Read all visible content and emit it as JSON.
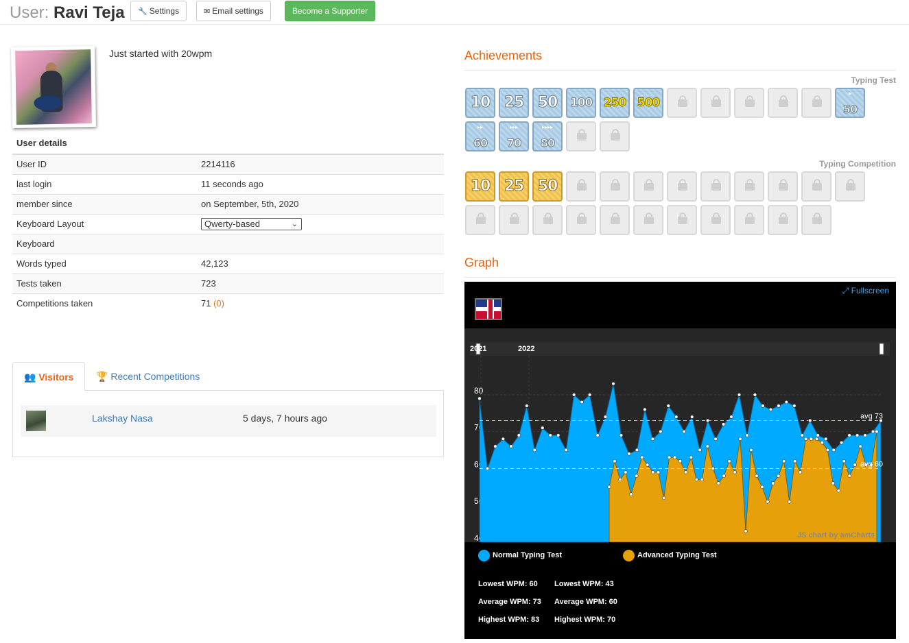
{
  "header": {
    "prefix": "User:",
    "username": "Ravi Teja",
    "settings_label": "Settings",
    "email_settings_label": "Email settings",
    "supporter_label": "Become a Supporter"
  },
  "profile": {
    "tagline": "Just started with 20wpm",
    "details_title": "User details",
    "rows": [
      {
        "label": "User ID",
        "value": "2214116"
      },
      {
        "label": "last login",
        "value": "11 seconds ago"
      },
      {
        "label": "member since",
        "value": "on September, 5th, 2020"
      },
      {
        "label": "Keyboard Layout",
        "value": "Qwerty-based"
      },
      {
        "label": "Keyboard",
        "value": ""
      },
      {
        "label": "Words typed",
        "value": "42,123"
      },
      {
        "label": "Tests taken",
        "value": "723"
      },
      {
        "label": "Competitions taken",
        "value": "71",
        "extra": "(0)"
      }
    ]
  },
  "tabs": {
    "visitors_label": "Visitors",
    "competitions_label": "Recent Competitions",
    "visitors": [
      {
        "name": "Lakshay Nasa",
        "time": "5 days, 7 hours ago"
      }
    ]
  },
  "achievements": {
    "title": "Achievements",
    "typing_test_label": "Typing Test",
    "typing_competition_label": "Typing Competition",
    "typing_test_badges": [
      {
        "label": "10",
        "unlocked": true
      },
      {
        "label": "25",
        "unlocked": true
      },
      {
        "label": "50",
        "unlocked": true
      },
      {
        "label": "100",
        "unlocked": true
      },
      {
        "label": "250",
        "unlocked": true
      },
      {
        "label": "500",
        "unlocked": true
      },
      {
        "label": "",
        "unlocked": false
      },
      {
        "label": "",
        "unlocked": false
      },
      {
        "label": "",
        "unlocked": false
      },
      {
        "label": "",
        "unlocked": false
      },
      {
        "label": "",
        "unlocked": false
      },
      {
        "label": "50",
        "unlocked": true
      },
      {
        "label": "60",
        "unlocked": true
      },
      {
        "label": "70",
        "unlocked": true
      },
      {
        "label": "80",
        "unlocked": true
      },
      {
        "label": "",
        "unlocked": false
      },
      {
        "label": "",
        "unlocked": false
      }
    ],
    "competition_badges": [
      {
        "label": "10",
        "unlocked": true
      },
      {
        "label": "25",
        "unlocked": true
      },
      {
        "label": "50",
        "unlocked": true
      }
    ],
    "competition_locked_count": 20
  },
  "graph": {
    "title": "Graph",
    "fullscreen_label": "Fullscreen",
    "credit": "JS chart by amCharts",
    "colors": {
      "normal": "#00aaff",
      "advanced": "#e6a00a"
    }
  },
  "chart_data": {
    "type": "area",
    "x_ticks": [
      "2021",
      "2022"
    ],
    "y_ticks": [
      40,
      50,
      60,
      70,
      80
    ],
    "ylim": [
      40,
      85
    ],
    "series": [
      {
        "name": "Normal Typing Test",
        "avg_label": "avg 73",
        "avg": 73,
        "values": [
          79,
          60,
          66,
          68,
          66,
          69,
          77,
          65,
          71,
          69,
          69,
          65,
          80,
          78,
          80,
          69,
          74,
          83,
          69,
          64,
          65,
          76,
          68,
          70,
          77,
          74,
          70,
          74,
          65,
          73,
          68,
          72,
          74,
          80,
          69,
          80,
          77,
          76,
          77,
          78,
          77,
          69,
          73,
          69,
          68,
          65,
          67,
          69,
          69,
          69,
          70,
          73
        ]
      },
      {
        "name": "Advanced Typing Test",
        "avg_label": "avg 60",
        "avg": 60,
        "values": [
          55,
          62,
          57,
          59,
          53,
          58,
          63,
          61,
          59,
          59,
          52,
          63,
          63,
          62,
          59,
          63,
          57,
          57,
          66,
          60,
          56,
          58,
          62,
          59,
          68,
          43,
          65,
          58,
          55,
          51,
          56,
          58,
          62,
          51,
          62,
          59,
          68,
          68,
          68,
          67,
          65,
          56,
          54,
          62,
          58,
          61,
          66,
          61,
          61,
          70
        ]
      }
    ],
    "stats": [
      {
        "lowest": "Lowest WPM: 60",
        "average": "Average WPM: 73",
        "highest": "Highest WPM: 83"
      },
      {
        "lowest": "Lowest WPM: 43",
        "average": "Average WPM: 60",
        "highest": "Highest WPM: 70"
      }
    ]
  }
}
